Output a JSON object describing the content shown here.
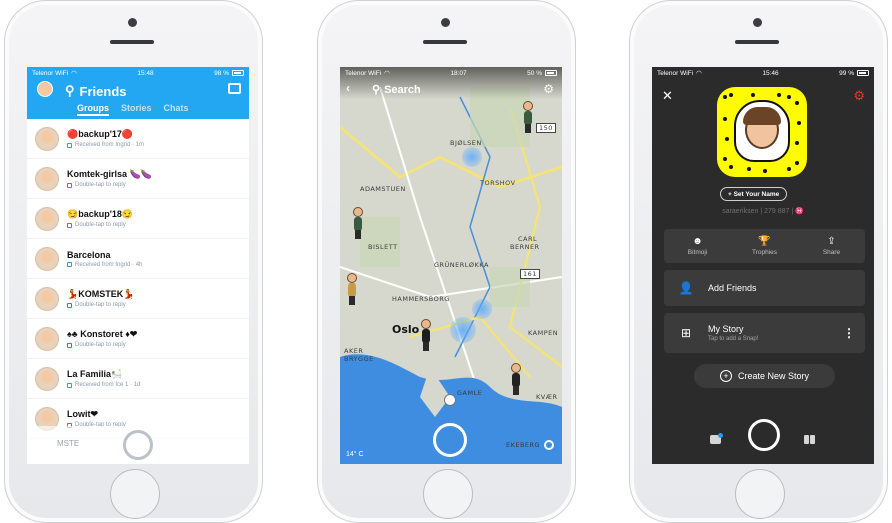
{
  "phone1": {
    "status": {
      "carrier": "Telenor WiFi",
      "time": "15:48",
      "battery": "98 %"
    },
    "title": "Friends",
    "tabs": [
      "Groups",
      "Stories",
      "Chats"
    ],
    "rows": [
      {
        "name": "🔴backup'17🔴",
        "sub": "Received from Ingrid · 1m",
        "marker": "blue"
      },
      {
        "name": "Komtek-girlsa 🍆🍆",
        "sub": "Double-tap to reply",
        "marker": "purple"
      },
      {
        "name": "😏backup'18😏",
        "sub": "Double-tap to reply",
        "marker": "purple"
      },
      {
        "name": "Barcelona",
        "sub": "Received from Ingrid · 4h",
        "marker": "blue"
      },
      {
        "name": "💃KOMSTEK💃",
        "sub": "Double-tap to reply",
        "marker": "red"
      },
      {
        "name": "♠♣ Konstoret ♦❤",
        "sub": "Double-tap to reply",
        "marker": "red"
      },
      {
        "name": "La Familia🛀",
        "sub": "Received from Ice 1 · 1d",
        "marker": "blue"
      },
      {
        "name": "Lowit❤",
        "sub": "Double-tap to reply",
        "marker": "purple"
      }
    ],
    "ghost_row": "MSTE"
  },
  "phone2": {
    "status": {
      "carrier": "Telenor WiFi",
      "time": "18:07",
      "battery": "50 %"
    },
    "search": "Search",
    "labels": {
      "bjolsen": "BJØLSEN",
      "adamstuen": "ADAMSTUEN",
      "torshov": "TORSHOV",
      "bislett": "BISLETT",
      "carl_berner_1": "CARL",
      "carl_berner_2": "BERNER",
      "grunerlokka": "GRÜNERLØKKA",
      "hammersborg": "HAMMERSBORG",
      "oslo": "Oslo",
      "kampen": "KAMPEN",
      "aker_1": "AKER",
      "aker_2": "BRYGGE",
      "gamle": "GAMLE",
      "kvaer": "KVÆR",
      "ekeberg": "EKEBERG",
      "road_150": "150",
      "road_161": "161"
    },
    "temperature": "14° C"
  },
  "phone3": {
    "status": {
      "carrier": "Telenor WiFi",
      "time": "15:46",
      "battery": "99 %"
    },
    "set_name": "+ Set Your Name",
    "username": "saraeriksen | 279 887 | ♓",
    "strip": [
      {
        "icon": "☻",
        "label": "Bitmoji"
      },
      {
        "icon": "🏆",
        "label": "Trophies"
      },
      {
        "icon": "⇪",
        "label": "Share"
      }
    ],
    "add_friends": "Add Friends",
    "my_story": "My Story",
    "my_story_sub": "Tap to add a Snap!",
    "create_story": "Create New Story"
  },
  "colors": {
    "snapchat_blue": "#23a7f2",
    "snapcode_yellow": "#fffc00",
    "settings_red": "#e8362c",
    "profile_bg": "#2b2b2b"
  }
}
